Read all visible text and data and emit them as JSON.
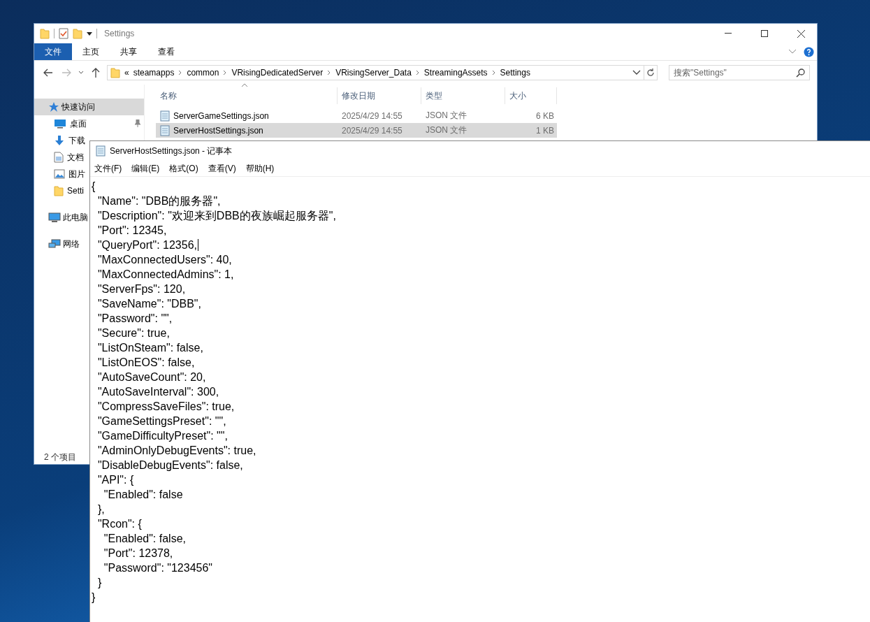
{
  "explorer": {
    "title": "Settings",
    "ribbon_tabs": [
      {
        "label": "文件",
        "selected": true
      },
      {
        "label": "主页",
        "selected": false
      },
      {
        "label": "共享",
        "selected": false
      },
      {
        "label": "查看",
        "selected": false
      }
    ],
    "address": {
      "overflow": "«",
      "crumbs": [
        "steamapps",
        "common",
        "VRisingDedicatedServer",
        "VRisingServer_Data",
        "StreamingAssets",
        "Settings"
      ]
    },
    "search": {
      "placeholder": "搜索\"Settings\""
    },
    "nav_items": [
      {
        "label": "快速访问",
        "kind": "quickaccess",
        "selected": true,
        "pinned": false
      },
      {
        "label": "桌面",
        "kind": "desktop",
        "selected": false,
        "pinned": true
      },
      {
        "label": "下载",
        "kind": "downloads",
        "selected": false,
        "pinned": false
      },
      {
        "label": "文档",
        "kind": "documents",
        "selected": false,
        "pinned": false
      },
      {
        "label": "图片",
        "kind": "pictures",
        "selected": false,
        "pinned": false
      },
      {
        "label": "Setti",
        "kind": "folder",
        "selected": false,
        "pinned": false
      },
      {
        "label": "此电脑",
        "kind": "computer",
        "selected": false,
        "pinned": false
      },
      {
        "label": "网络",
        "kind": "network",
        "selected": false,
        "pinned": false
      }
    ],
    "columns": [
      "名称",
      "修改日期",
      "类型",
      "大小"
    ],
    "rows": [
      {
        "name": "ServerGameSettings.json",
        "modified": "2025/4/29 14:55",
        "type": "JSON 文件",
        "size": "6 KB",
        "selected": false
      },
      {
        "name": "ServerHostSettings.json",
        "modified": "2025/4/29 14:55",
        "type": "JSON 文件",
        "size": "1 KB",
        "selected": true
      }
    ],
    "status_bar": "2 个项目"
  },
  "notepad": {
    "title": "ServerHostSettings.json - 记事本",
    "menu": [
      "文件(F)",
      "编辑(E)",
      "格式(O)",
      "查看(V)",
      "帮助(H)"
    ],
    "lines": [
      {
        "text": "{",
        "caret": false
      },
      {
        "text": "  \"Name\": \"DBB的服务器\",",
        "caret": false
      },
      {
        "text": "  \"Description\": \"欢迎来到DBB的夜族崛起服务器\",",
        "caret": false
      },
      {
        "text": "  \"Port\": 12345,",
        "caret": false
      },
      {
        "text": "  \"QueryPort\": 12356,",
        "caret": true
      },
      {
        "text": "  \"MaxConnectedUsers\": 40,",
        "caret": false
      },
      {
        "text": "  \"MaxConnectedAdmins\": 1,",
        "caret": false
      },
      {
        "text": "  \"ServerFps\": 120,",
        "caret": false
      },
      {
        "text": "  \"SaveName\": \"DBB\",",
        "caret": false
      },
      {
        "text": "  \"Password\": \"\",",
        "caret": false
      },
      {
        "text": "  \"Secure\": true,",
        "caret": false
      },
      {
        "text": "  \"ListOnSteam\": false,",
        "caret": false
      },
      {
        "text": "  \"ListOnEOS\": false,",
        "caret": false
      },
      {
        "text": "  \"AutoSaveCount\": 20,",
        "caret": false
      },
      {
        "text": "  \"AutoSaveInterval\": 300,",
        "caret": false
      },
      {
        "text": "  \"CompressSaveFiles\": true,",
        "caret": false
      },
      {
        "text": "  \"GameSettingsPreset\": \"\",",
        "caret": false
      },
      {
        "text": "  \"GameDifficultyPreset\": \"\",",
        "caret": false
      },
      {
        "text": "  \"AdminOnlyDebugEvents\": true,",
        "caret": false
      },
      {
        "text": "  \"DisableDebugEvents\": false,",
        "caret": false
      },
      {
        "text": "  \"API\": {",
        "caret": false
      },
      {
        "text": "    \"Enabled\": false",
        "caret": false
      },
      {
        "text": "  },",
        "caret": false
      },
      {
        "text": "  \"Rcon\": {",
        "caret": false
      },
      {
        "text": "    \"Enabled\": false,",
        "caret": false
      },
      {
        "text": "    \"Port\": 12378,",
        "caret": false
      },
      {
        "text": "    \"Password\": \"123456\"",
        "caret": false
      },
      {
        "text": "  }",
        "caret": false
      },
      {
        "text": "}",
        "caret": false
      }
    ]
  }
}
